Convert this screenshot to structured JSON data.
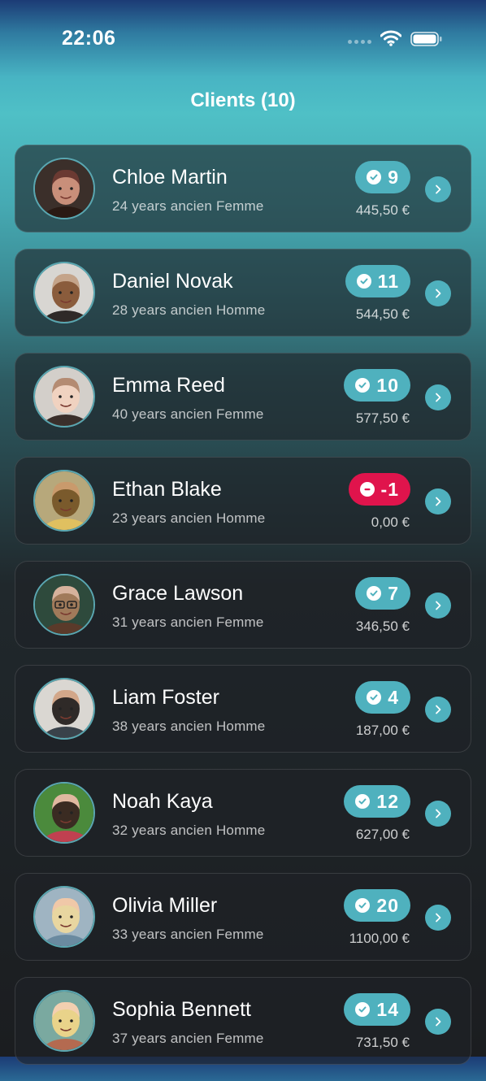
{
  "status": {
    "time": "22:06"
  },
  "header": {
    "title": "Clients (10)"
  },
  "colors": {
    "accent": "#4fb1be",
    "negative": "#e0144c"
  },
  "clients": [
    {
      "name": "Chloe Martin",
      "subtitle": "24 years ancien Femme",
      "count": "9",
      "amount": "445,50 €",
      "status": "positive"
    },
    {
      "name": "Daniel Novak",
      "subtitle": "28 years ancien Homme",
      "count": "11",
      "amount": "544,50 €",
      "status": "positive"
    },
    {
      "name": "Emma Reed",
      "subtitle": "40 years ancien Femme",
      "count": "10",
      "amount": "577,50 €",
      "status": "positive"
    },
    {
      "name": "Ethan Blake",
      "subtitle": "23 years ancien Homme",
      "count": "-1",
      "amount": "0,00 €",
      "status": "negative"
    },
    {
      "name": "Grace Lawson",
      "subtitle": "31 years ancien Femme",
      "count": "7",
      "amount": "346,50 €",
      "status": "positive"
    },
    {
      "name": "Liam Foster",
      "subtitle": "38 years ancien Homme",
      "count": "4",
      "amount": "187,00 €",
      "status": "positive"
    },
    {
      "name": "Noah Kaya",
      "subtitle": "32 years ancien Homme",
      "count": "12",
      "amount": "627,00 €",
      "status": "positive"
    },
    {
      "name": "Olivia Miller",
      "subtitle": "33 years ancien Femme",
      "count": "20",
      "amount": "1100,00 €",
      "status": "positive"
    },
    {
      "name": "Sophia Bennett",
      "subtitle": "37 years ancien Femme",
      "count": "14",
      "amount": "731,50 €",
      "status": "positive"
    }
  ]
}
